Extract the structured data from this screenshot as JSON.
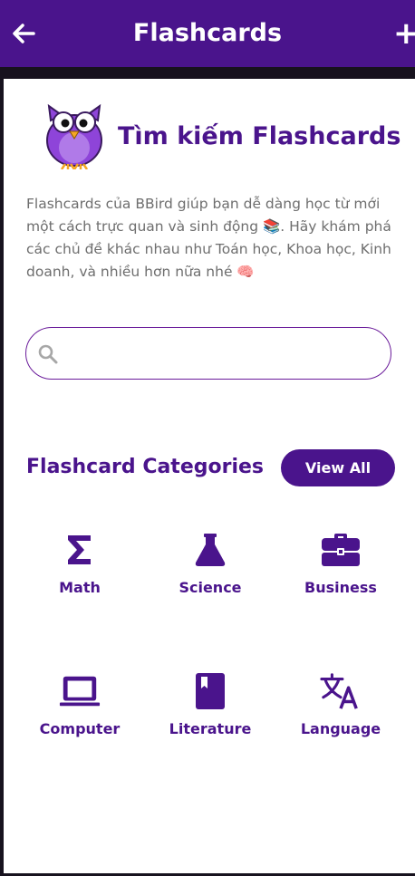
{
  "appbar": {
    "title": "Flashcards",
    "back_icon": "arrow-left-icon",
    "add_label": "+"
  },
  "hero": {
    "mascot": "owl-logo",
    "title": "Tìm kiếm Flashcards",
    "description": "Flashcards của BBird giúp bạn dễ dàng học từ mới một cách trực quan và sinh động 📚. Hãy khám phá các chủ đề khác nhau như Toán học, Khoa học, Kinh doanh, và nhiều hơn nữa nhé 🧠"
  },
  "search": {
    "placeholder": "",
    "value": "",
    "icon": "search-icon"
  },
  "categories": {
    "title": "Flashcard Categories",
    "view_all_label": "View All",
    "items": [
      {
        "label": "Math",
        "icon": "sigma-icon"
      },
      {
        "label": "Science",
        "icon": "flask-icon"
      },
      {
        "label": "Business",
        "icon": "briefcase-icon"
      },
      {
        "label": "Computer",
        "icon": "laptop-icon"
      },
      {
        "label": "Literature",
        "icon": "book-icon"
      },
      {
        "label": "Language",
        "icon": "translate-icon"
      }
    ]
  },
  "colors": {
    "primary": "#4a148c",
    "text_muted": "#6e6e6e",
    "background": "#ffffff"
  }
}
